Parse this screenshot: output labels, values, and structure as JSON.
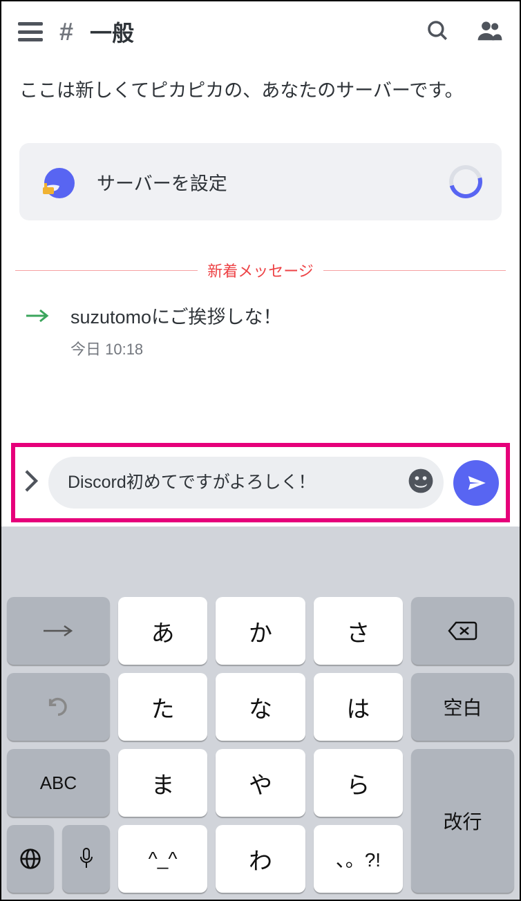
{
  "header": {
    "channel_name": "一般"
  },
  "welcome": "ここは新しくてピカピカの、あなたのサーバーです。",
  "card": {
    "label": "サーバーを設定"
  },
  "divider_label": "新着メッセージ",
  "system_message": {
    "text": "suzutomoにご挨拶しな！",
    "timestamp": "今日 10:18"
  },
  "composer": {
    "text": "Discord初めてですがよろしく！"
  },
  "keyboard": {
    "row1": [
      "→",
      "あ",
      "か",
      "さ",
      "⌫"
    ],
    "row2": [
      "↺",
      "た",
      "な",
      "は",
      "空白"
    ],
    "row3_abc": "ABC",
    "row3": [
      "ま",
      "や",
      "ら"
    ],
    "row3_kaigyo": "改行",
    "row4_globe": "🌐",
    "row4_mic": "🎤",
    "row4": [
      "^_^",
      "わ",
      "、。?!"
    ]
  }
}
